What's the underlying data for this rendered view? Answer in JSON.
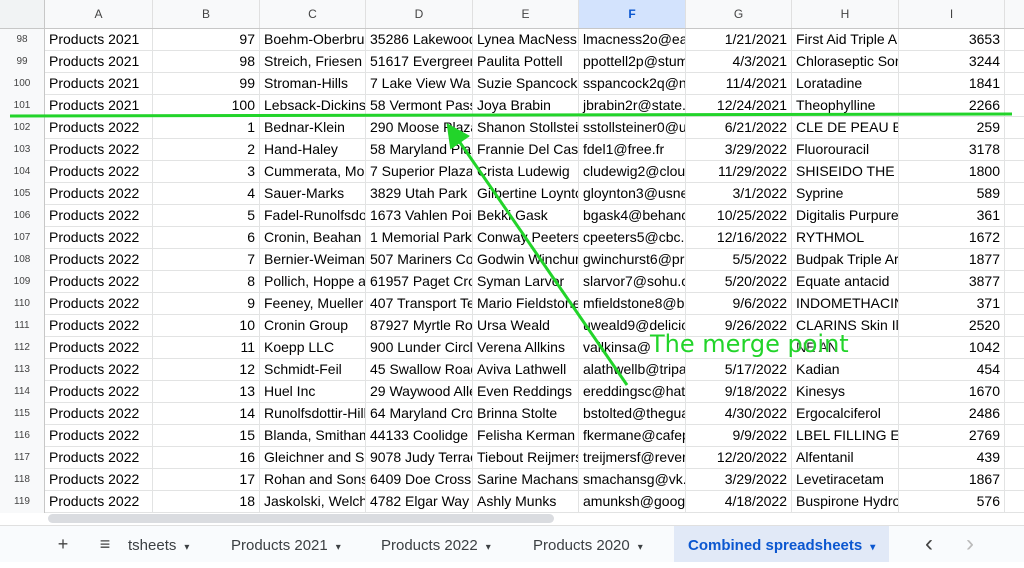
{
  "columns": [
    {
      "letter": "A",
      "width": 108
    },
    {
      "letter": "B",
      "width": 107
    },
    {
      "letter": "C",
      "width": 106
    },
    {
      "letter": "D",
      "width": 107
    },
    {
      "letter": "E",
      "width": 106
    },
    {
      "letter": "F",
      "width": 107,
      "selected": true
    },
    {
      "letter": "G",
      "width": 106
    },
    {
      "letter": "H",
      "width": 107
    },
    {
      "letter": "I",
      "width": 106
    }
  ],
  "rows": [
    {
      "n": "98",
      "cells": [
        "Products 2021",
        "97",
        "Boehm-Oberbrunner",
        "35286 Lakewood",
        "Lynea MacNess",
        "lmacness2o@ea",
        "1/21/2021",
        "First Aid Triple A",
        "3653"
      ]
    },
    {
      "n": "99",
      "cells": [
        "Products 2021",
        "98",
        "Streich, Friesen",
        "51617 Evergreen",
        "Paulita Pottell",
        "ppottell2p@stum",
        "4/3/2021",
        "Chloraseptic Sor",
        "3244"
      ]
    },
    {
      "n": "100",
      "cells": [
        "Products 2021",
        "99",
        "Stroman-Hills",
        "7 Lake View Wa",
        "Suzie Spancock",
        "sspancock2q@n",
        "11/4/2021",
        "Loratadine",
        "1841"
      ]
    },
    {
      "n": "101",
      "cells": [
        "Products 2021",
        "100",
        "Lebsack-Dickinson",
        "58 Vermont Pass",
        "Joya Brabin",
        "jbrabin2r@state.",
        "12/24/2021",
        "Theophylline",
        "2266"
      ]
    },
    {
      "n": "102",
      "cells": [
        "Products 2022",
        "1",
        "Bednar-Klein",
        "290 Moose Plaza",
        "Shanon Stollsteimer",
        "sstollsteiner0@u",
        "6/21/2022",
        "CLE DE PEAU B",
        "259"
      ]
    },
    {
      "n": "103",
      "cells": [
        "Products 2022",
        "2",
        "Hand-Haley",
        "58 Maryland Pla",
        "Frannie Del Cas",
        "fdel1@free.fr",
        "3/29/2022",
        "Fluorouracil",
        "3178"
      ]
    },
    {
      "n": "104",
      "cells": [
        "Products 2022",
        "3",
        "Cummerata, Mo",
        "7 Superior Plaza",
        "Crista Ludewig",
        "cludewig2@clou",
        "11/29/2022",
        "SHISEIDO THE",
        "1800"
      ]
    },
    {
      "n": "105",
      "cells": [
        "Products 2022",
        "4",
        "Sauer-Marks",
        "3829 Utah Park",
        "Gilbertine Loynton",
        "gloynton3@usne",
        "3/1/2022",
        "Syprine",
        "589"
      ]
    },
    {
      "n": "106",
      "cells": [
        "Products 2022",
        "5",
        "Fadel-Runolfsdottir",
        "1673 Vahlen Poi",
        "Bekki Gask",
        "bgask4@behanc",
        "10/25/2022",
        "Digitalis Purpure",
        "361"
      ]
    },
    {
      "n": "107",
      "cells": [
        "Products 2022",
        "6",
        "Cronin, Beahan",
        "1 Memorial Park",
        "Conway Peeters",
        "cpeeters5@cbc.",
        "12/16/2022",
        "RYTHMOL",
        "1672"
      ]
    },
    {
      "n": "108",
      "cells": [
        "Products 2022",
        "7",
        "Bernier-Weiman",
        "507 Mariners Co",
        "Godwin Winchurst",
        "gwinchurst6@pr",
        "5/5/2022",
        "Budpak Triple Ar",
        "1877"
      ]
    },
    {
      "n": "109",
      "cells": [
        "Products 2022",
        "8",
        "Pollich, Hoppe a",
        "61957 Paget Cro",
        "Syman Larvor",
        "slarvor7@sohu.c",
        "5/20/2022",
        "Equate antacid",
        "3877"
      ]
    },
    {
      "n": "110",
      "cells": [
        "Products 2022",
        "9",
        "Feeney, Mueller",
        "407 Transport Te",
        "Mario Fieldstone",
        "mfieldstone8@b",
        "9/6/2022",
        "INDOMETHACIN",
        "371"
      ]
    },
    {
      "n": "111",
      "cells": [
        "Products 2022",
        "10",
        "Cronin Group",
        "87927 Myrtle Ro",
        "Ursa Weald",
        "uweald9@delicio",
        "9/26/2022",
        "CLARINS Skin Il",
        "2520"
      ]
    },
    {
      "n": "112",
      "cells": [
        "Products 2022",
        "11",
        "Koepp LLC",
        "900 Lunder Circl",
        "Verena Allkins",
        "vallkinsa@",
        "",
        "NE AN",
        "1042"
      ]
    },
    {
      "n": "113",
      "cells": [
        "Products 2022",
        "12",
        "Schmidt-Feil",
        "45 Swallow Road",
        "Aviva Lathwell",
        "alathwellb@tripa",
        "5/17/2022",
        "Kadian",
        "454"
      ]
    },
    {
      "n": "114",
      "cells": [
        "Products 2022",
        "13",
        "Huel Inc",
        "29 Waywood Alle",
        "Even Reddings",
        "ereddingsc@hat",
        "9/18/2022",
        "Kinesys",
        "1670"
      ]
    },
    {
      "n": "115",
      "cells": [
        "Products 2022",
        "14",
        "Runolfsdottir-Hill",
        "64 Maryland Cro",
        "Brinna Stolte",
        "bstolted@thegua",
        "4/30/2022",
        "Ergocalciferol",
        "2486"
      ]
    },
    {
      "n": "116",
      "cells": [
        "Products 2022",
        "15",
        "Blanda, Smitham",
        "44133 Coolidge",
        "Felisha Kerman",
        "fkermane@cafep",
        "9/9/2022",
        "LBEL FILLING E",
        "2769"
      ]
    },
    {
      "n": "117",
      "cells": [
        "Products 2022",
        "16",
        "Gleichner and Sons",
        "9078 Judy Terrace",
        "Tiebout Reijmers",
        "treijmersf@rever",
        "12/20/2022",
        "Alfentanil",
        "439"
      ]
    },
    {
      "n": "118",
      "cells": [
        "Products 2022",
        "17",
        "Rohan and Sons",
        "6409 Doe Cross",
        "Sarine Machans",
        "smachansg@vk.",
        "3/29/2022",
        "Levetiracetam",
        "1867"
      ]
    },
    {
      "n": "119",
      "cells": [
        "Products 2022",
        "18",
        "Jaskolski, Welch",
        "4782 Elgar Way",
        "Ashly Munks",
        "amunksh@goog",
        "4/18/2022",
        "Buspirone Hydro",
        "576"
      ]
    }
  ],
  "tabs": {
    "add_icon": "+",
    "menu_icon": "≡",
    "items": [
      {
        "label": "tsheets",
        "active": false
      },
      {
        "label": "Products 2021",
        "active": false
      },
      {
        "label": "Products 2022",
        "active": false
      },
      {
        "label": "Products 2020",
        "active": false
      },
      {
        "label": "Combined spreadsheets",
        "active": true
      }
    ],
    "caret": "▾",
    "prev_icon": "‹",
    "next_icon": "›"
  },
  "annotation": {
    "label": "The merge point",
    "color": "#22d42a"
  }
}
